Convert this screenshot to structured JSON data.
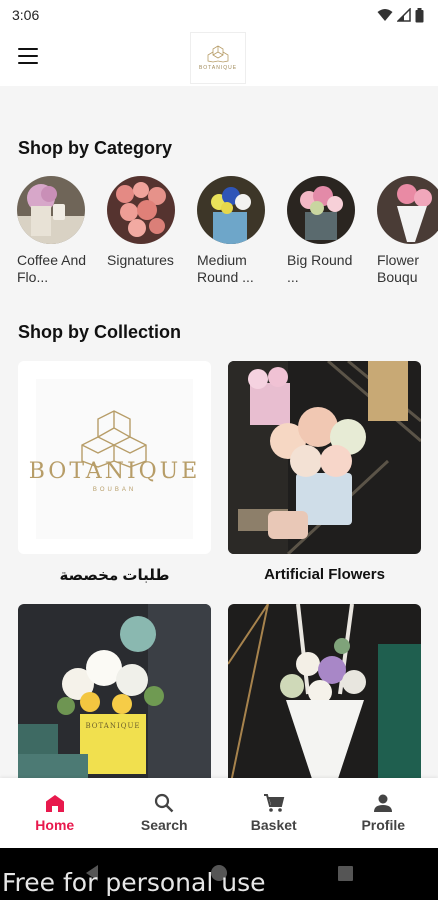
{
  "status_bar": {
    "time": "3:06"
  },
  "header": {
    "logo_text": "BOTANIQUE"
  },
  "sections": {
    "category_title": "Shop by Category",
    "collection_title": "Shop by Collection"
  },
  "categories": [
    {
      "label": "Coffee And Flo...",
      "icon": "coffee-flowers-image"
    },
    {
      "label": "Signatures",
      "icon": "signature-image"
    },
    {
      "label": "Medium Round ...",
      "icon": "medium-round-image"
    },
    {
      "label": "Big Round ...",
      "icon": "big-round-image"
    },
    {
      "label": "Flower Bouqu",
      "icon": "bouquet-image"
    }
  ],
  "collections": [
    {
      "title": "طلبات مخصصة",
      "logo_main": "BOTANIQUE",
      "logo_sub": "BOUBAN"
    },
    {
      "title": "Artificial Flowers"
    },
    {
      "title": "",
      "box_label": "BOTANIQUE"
    },
    {
      "title": ""
    }
  ],
  "nav": {
    "home": "Home",
    "search": "Search",
    "basket": "Basket",
    "profile": "Profile"
  },
  "colors": {
    "accent": "#e8194d",
    "background": "#f5f5f5"
  },
  "watermark": "Free for personal use"
}
